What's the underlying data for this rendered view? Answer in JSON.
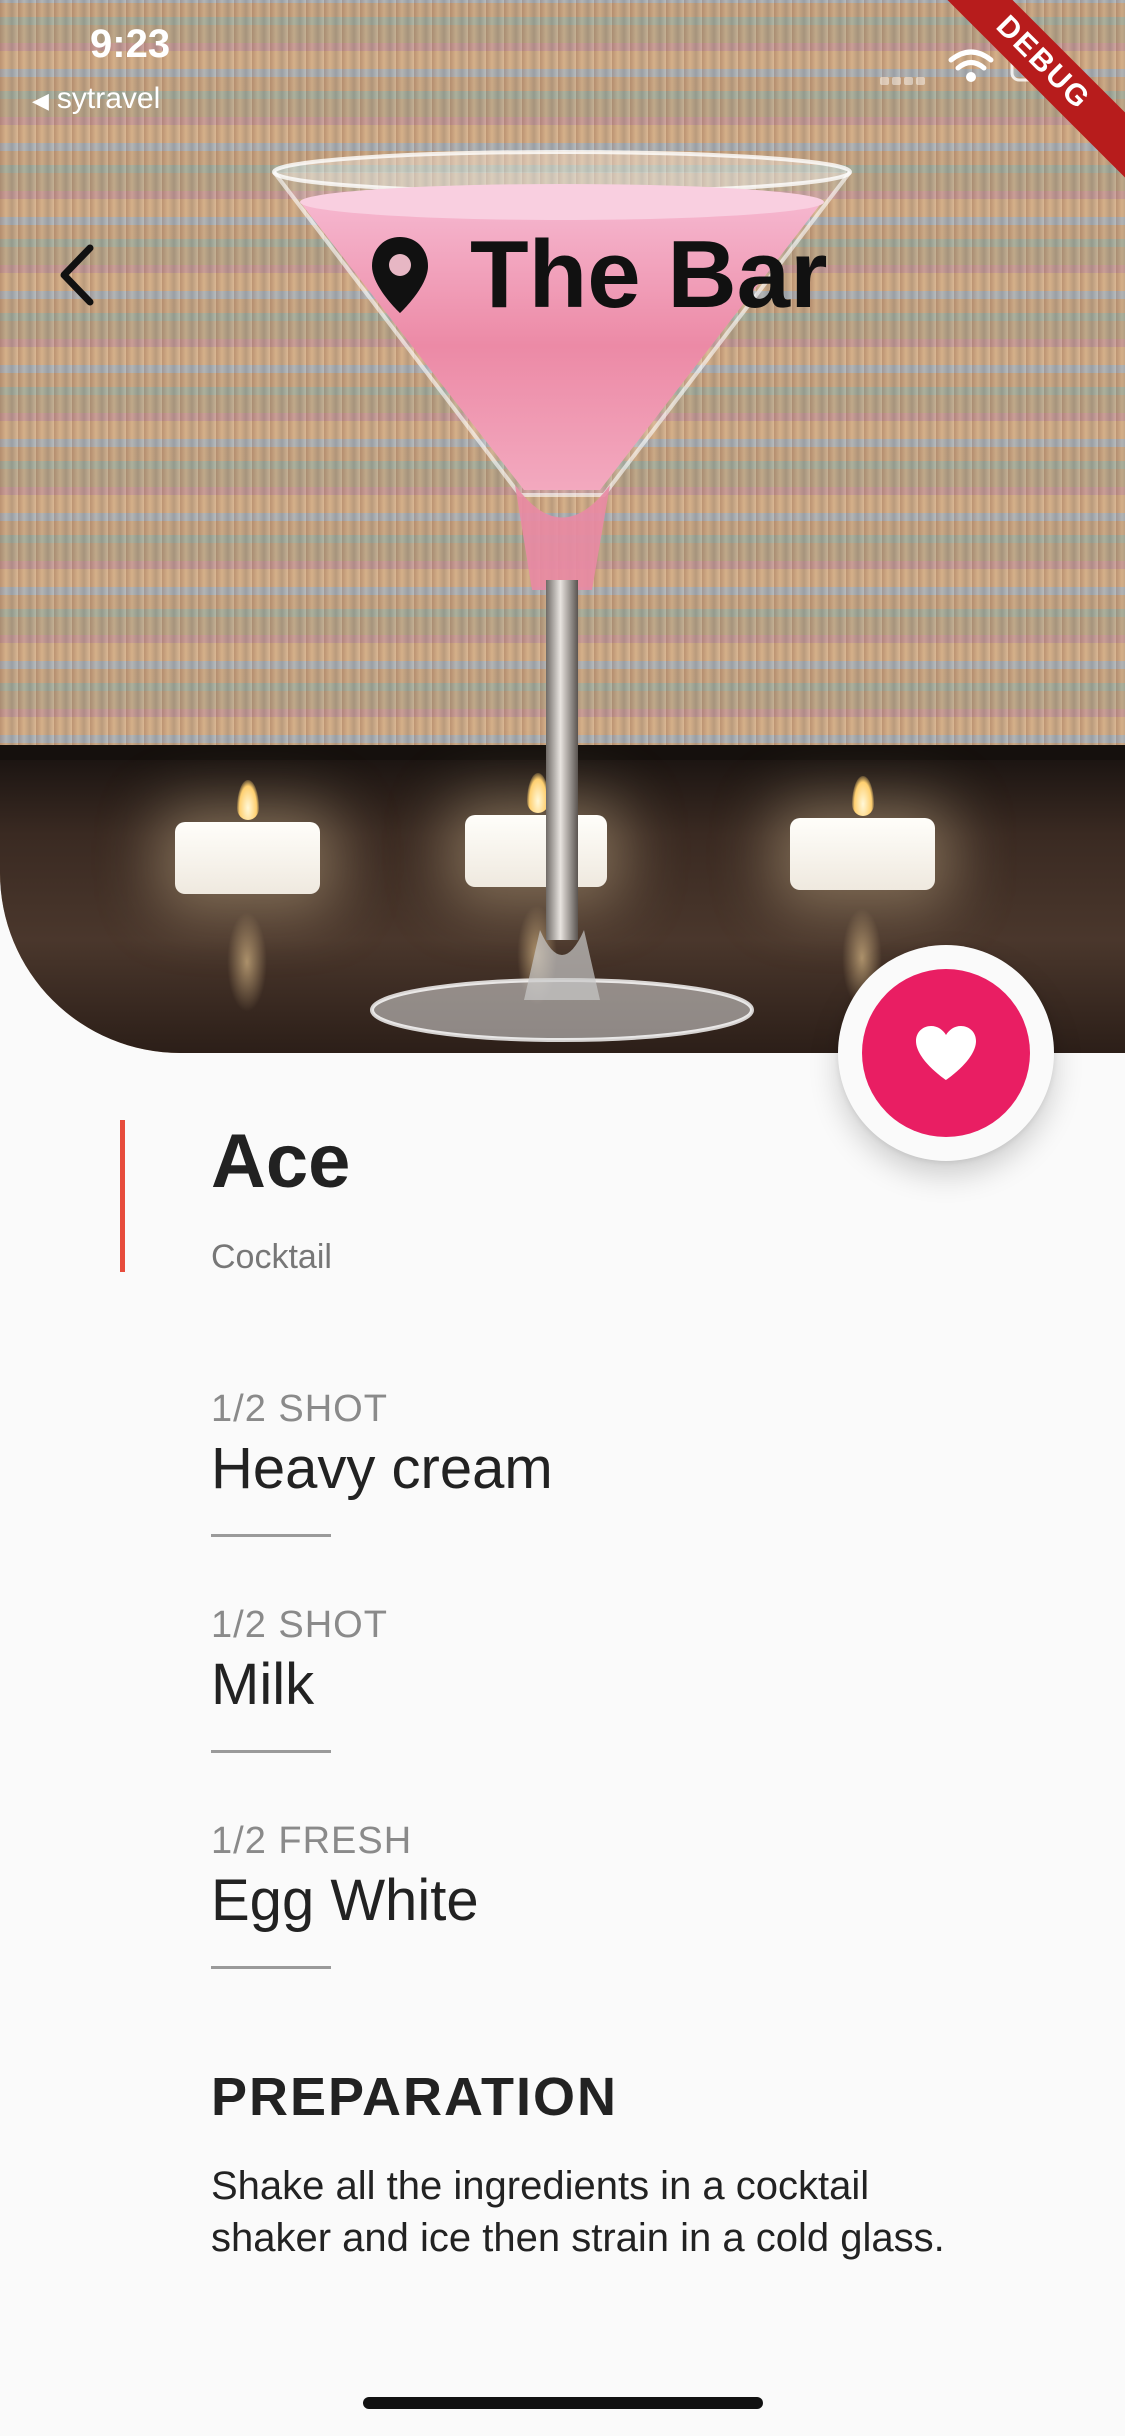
{
  "status_bar": {
    "time": "9:23",
    "back_app": "sytravel"
  },
  "debug_banner": "DEBUG",
  "header": {
    "title": "The Bar"
  },
  "drink": {
    "name": "Ace",
    "category": "Cocktail"
  },
  "ingredients": [
    {
      "measure": "1/2 SHOT",
      "name": "Heavy cream"
    },
    {
      "measure": "1/2 SHOT",
      "name": "Milk"
    },
    {
      "measure": "1/2 FRESH",
      "name": "Egg White"
    }
  ],
  "preparation": {
    "heading": "PREPARATION",
    "text": "Shake all the ingredients in a cocktail shaker and ice then strain in a cold glass."
  },
  "colors": {
    "accent": "#e91e63",
    "accent_line": "#e74c3c",
    "debug": "#b71c1c"
  },
  "icons": {
    "back": "chevron-left-icon",
    "location": "map-pin-icon",
    "favorite": "heart-icon",
    "wifi": "wifi-icon",
    "battery": "battery-icon"
  }
}
